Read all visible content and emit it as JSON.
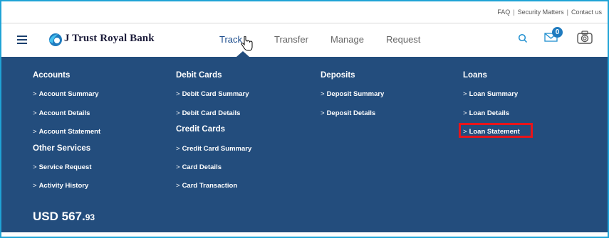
{
  "top_links": {
    "faq": "FAQ",
    "security": "Security Matters",
    "contact": "Contact us",
    "separator": "|"
  },
  "brand": {
    "name": "J Trust Royal Bank",
    "logo_icon": "jtrust-logo-icon"
  },
  "nav": {
    "tabs": [
      {
        "label": "Track",
        "active": true
      },
      {
        "label": "Transfer",
        "active": false
      },
      {
        "label": "Manage",
        "active": false
      },
      {
        "label": "Request",
        "active": false
      }
    ],
    "mail_badge": "0"
  },
  "menu": {
    "accounts": {
      "heading": "Accounts",
      "items": [
        "Account Summary",
        "Account Details",
        "Account Statement"
      ]
    },
    "other_services": {
      "heading": "Other Services",
      "items": [
        "Service Request",
        "Activity History"
      ]
    },
    "debit_cards": {
      "heading": "Debit Cards",
      "items": [
        "Debit Card Summary",
        "Debit Card Details"
      ]
    },
    "credit_cards": {
      "heading": "Credit Cards",
      "items": [
        "Credit Card Summary",
        "Card Details",
        "Card Transaction"
      ]
    },
    "deposits": {
      "heading": "Deposits",
      "items": [
        "Deposit Summary",
        "Deposit Details"
      ]
    },
    "loans": {
      "heading": "Loans",
      "items": [
        "Loan Summary",
        "Loan Details",
        "Loan Statement"
      ]
    },
    "chevron": ">"
  },
  "balance": {
    "currency": "USD",
    "whole": "567.",
    "decimal": "93"
  },
  "colors": {
    "menu_bg": "#234d7d",
    "active_tab": "#1a4b8c",
    "highlight": "#e8141a",
    "frame": "#1fa3d6"
  }
}
